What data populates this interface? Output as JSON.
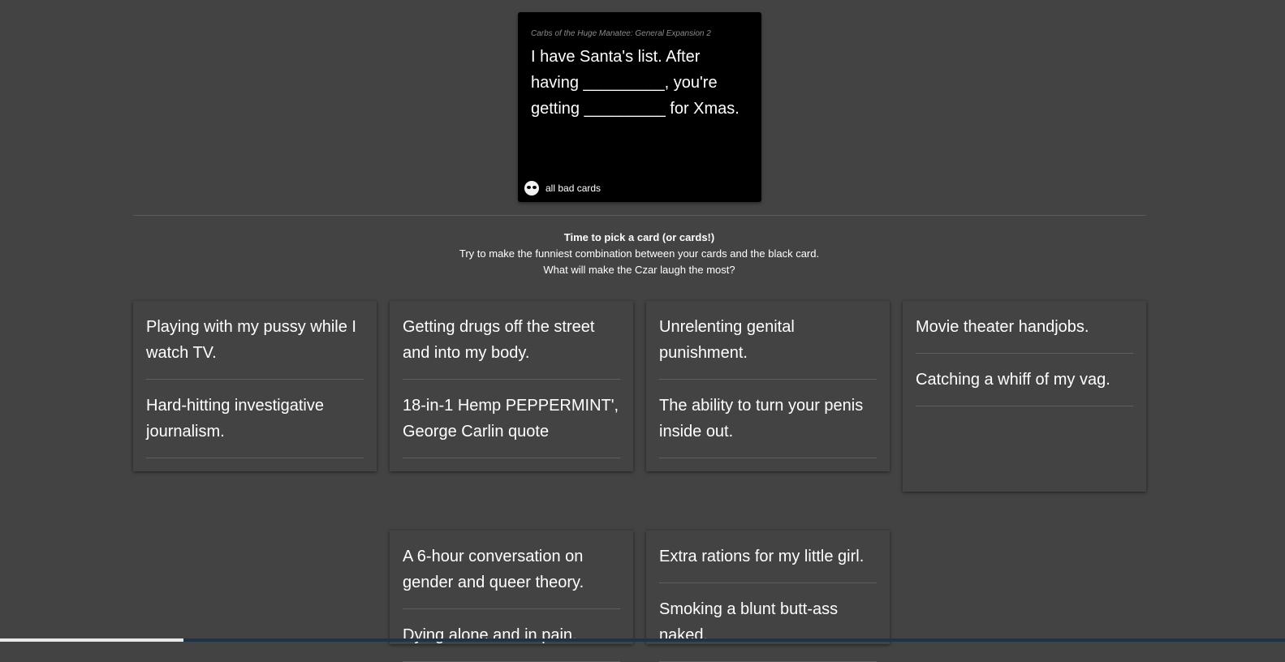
{
  "black_card": {
    "expansion": "Carbs of the Huge Manatee: General Expansion 2",
    "prompt": "I have Santa's list. After having _________, you're getting _________ for Xmas.",
    "brand": "all bad cards",
    "brand_icon": "skull-icon"
  },
  "instructions": {
    "heading": "Time to pick a card (or cards!)",
    "line1": "Try to make the funniest combination between your cards and the black card.",
    "line2": "What will make the Czar laugh the most?"
  },
  "answer_cards": [
    {
      "answers": [
        "Playing with my pussy while I watch TV.",
        "Hard-hitting investigative journalism."
      ]
    },
    {
      "answers": [
        "Getting drugs off the street and into my body.",
        "18-in-1 Hemp PEPPERMINT', George Carlin quote"
      ]
    },
    {
      "answers": [
        "Unrelenting genital punishment.",
        "The ability to turn your penis inside out."
      ]
    },
    {
      "answers": [
        "Movie theater handjobs.",
        "Catching a whiff of my vag."
      ]
    },
    {
      "answers": [
        "A 6-hour conversation on gender and queer theory.",
        "Dying alone and in pain."
      ]
    },
    {
      "answers": [
        "Extra rations for my little girl.",
        "Smoking a blunt butt-ass naked."
      ]
    }
  ],
  "loading_progress": 0.143
}
